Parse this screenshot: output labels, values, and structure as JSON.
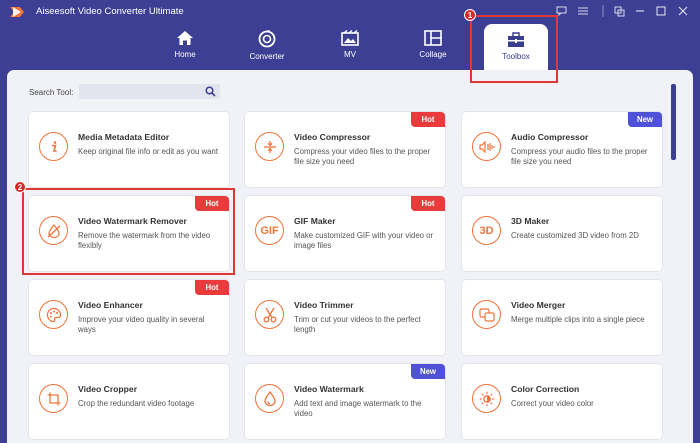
{
  "app": {
    "title": "Aiseesoft Video Converter Ultimate"
  },
  "nav": {
    "tabs": [
      {
        "label": "Home",
        "icon": "home-icon"
      },
      {
        "label": "Converter",
        "icon": "converter-icon"
      },
      {
        "label": "MV",
        "icon": "mv-icon"
      },
      {
        "label": "Collage",
        "icon": "collage-icon"
      },
      {
        "label": "Toolbox",
        "icon": "toolbox-icon",
        "active": true
      }
    ]
  },
  "search": {
    "label": "Search Tool:",
    "value": ""
  },
  "tools": [
    {
      "title": "Media Metadata Editor",
      "desc": "Keep original file info or edit as you want",
      "icon": "info-icon",
      "badge": ""
    },
    {
      "title": "Video Compressor",
      "desc": "Compress your video files to the proper file size you need",
      "icon": "compress-icon",
      "badge": "Hot"
    },
    {
      "title": "Audio Compressor",
      "desc": "Compress your audio files to the proper file size you need",
      "icon": "audio-compress-icon",
      "badge": "New"
    },
    {
      "title": "Video Watermark Remover",
      "desc": "Remove the watermark from the video flexibly",
      "icon": "watermark-remove-icon",
      "badge": "Hot"
    },
    {
      "title": "GIF Maker",
      "desc": "Make customized GIF with your video or image files",
      "icon": "gif-icon",
      "icon_text": "GIF",
      "badge": "Hot"
    },
    {
      "title": "3D Maker",
      "desc": "Create customized 3D video from 2D",
      "icon": "3d-icon",
      "icon_text": "3D",
      "badge": ""
    },
    {
      "title": "Video Enhancer",
      "desc": "Improve your video quality in several ways",
      "icon": "palette-icon",
      "badge": "Hot"
    },
    {
      "title": "Video Trimmer",
      "desc": "Trim or cut your videos to the perfect length",
      "icon": "scissors-icon",
      "badge": ""
    },
    {
      "title": "Video Merger",
      "desc": "Merge multiple clips into a single piece",
      "icon": "merge-icon",
      "badge": ""
    },
    {
      "title": "Video Cropper",
      "desc": "Crop the redundant video footage",
      "icon": "crop-icon",
      "badge": ""
    },
    {
      "title": "Video Watermark",
      "desc": "Add text and image watermark to the video",
      "icon": "droplet-icon",
      "badge": "New"
    },
    {
      "title": "Color Correction",
      "desc": "Correct your video color",
      "icon": "sun-icon",
      "badge": ""
    }
  ],
  "annotations": {
    "step1": "1",
    "step2": "2"
  },
  "colors": {
    "brand": "#3c3f93",
    "accent": "#f0733c",
    "hot": "#ea3b3c",
    "new": "#4f52d6",
    "highlight": "#e03636"
  }
}
